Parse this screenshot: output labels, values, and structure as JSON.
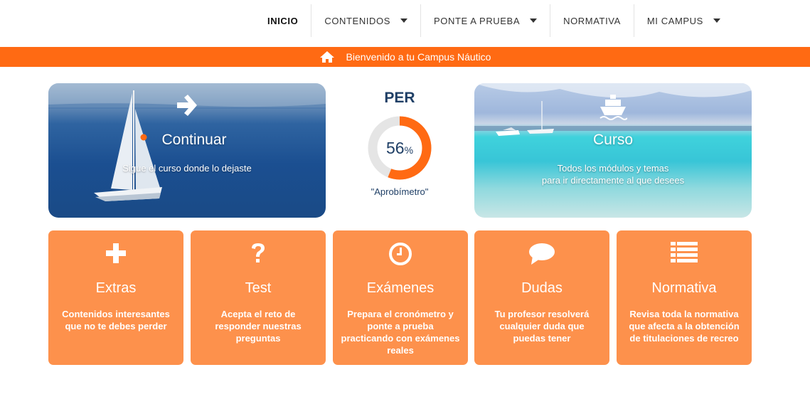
{
  "nav": {
    "items": [
      {
        "label": "INICIO"
      },
      {
        "label": "CONTENIDOS"
      },
      {
        "label": "PONTE A PRUEBA"
      },
      {
        "label": "NORMATIVA"
      },
      {
        "label": "MI CAMPUS"
      }
    ]
  },
  "banner": {
    "text": "Bienvenido a tu Campus Náutico",
    "icon": "home-icon",
    "color": "#ff6a13"
  },
  "hero": {
    "continue": {
      "title": "Continuar",
      "subtitle": "Sigue el curso donde lo dejaste",
      "icon": "arrow-right-icon"
    },
    "course": {
      "title": "Curso",
      "subtitle": "Todos los módulos y temas\npara ir directamente al que desees",
      "icon": "ship-icon"
    }
  },
  "progress": {
    "title": "PER",
    "value": "56",
    "unit": "%",
    "fraction": 0.56,
    "caption": "\"Aprobímetro\"",
    "color": "#ff6a13",
    "track_color": "#e5e5e5"
  },
  "cards": [
    {
      "title": "Extras",
      "desc": "Contenidos interesantes\nque no te debes perder",
      "icon": "plus-icon"
    },
    {
      "title": "Test",
      "desc": "Acepta el reto de\nresponder nuestras\npreguntas",
      "icon": "question-icon"
    },
    {
      "title": "Exámenes",
      "desc": "Prepara el cronómetro y\nponte a prueba\npracticando con exámenes\nreales",
      "icon": "clock-icon"
    },
    {
      "title": "Dudas",
      "desc": "Tu profesor resolverá\ncualquier duda que\npuedas tener",
      "icon": "speech-bubble-icon"
    },
    {
      "title": "Normativa",
      "desc": "Revisa toda la normativa\nque afecta a la obtención\nde titulaciones de recreo",
      "icon": "list-icon"
    }
  ],
  "colors": {
    "card": "#fd914c",
    "accent": "#ff6a13",
    "heading": "#1f3f66"
  }
}
